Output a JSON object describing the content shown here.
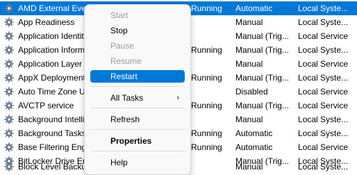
{
  "services": [
    {
      "name": "AMD External Events",
      "status": "Running",
      "startup": "Automatic",
      "logon": "Local Syste...",
      "selected": true
    },
    {
      "name": "App Readiness",
      "status": "",
      "startup": "Manual",
      "logon": "Local Syste..."
    },
    {
      "name": "Application Identity",
      "status": "",
      "startup": "Manual (Trig...",
      "logon": "Local Service"
    },
    {
      "name": "Application Information",
      "status": "Running",
      "startup": "Manual (Trig...",
      "logon": "Local Syste..."
    },
    {
      "name": "Application Layer Gateway",
      "status": "",
      "startup": "Manual",
      "logon": "Local Service"
    },
    {
      "name": "AppX Deployment Service",
      "status": "Running",
      "startup": "Manual (Trig...",
      "logon": "Local Syste..."
    },
    {
      "name": "Auto Time Zone Updater",
      "status": "",
      "startup": "Disabled",
      "logon": "Local Service"
    },
    {
      "name": "AVCTP service",
      "status": "Running",
      "startup": "Manual (Trig...",
      "logon": "Local Service"
    },
    {
      "name": "Background Intelligent",
      "status": "",
      "startup": "Manual",
      "logon": "Local Syste..."
    },
    {
      "name": "Background Tasks",
      "status": "Running",
      "startup": "Automatic",
      "logon": "Local Syste..."
    },
    {
      "name": "Base Filtering Engine",
      "status": "Running",
      "startup": "Automatic",
      "logon": "Local Service"
    },
    {
      "name": "BitLocker Drive Encryption",
      "status": "",
      "startup": "Manual (Trig...",
      "logon": "Local Syste..."
    },
    {
      "name": "Block Level Backup",
      "status": "",
      "startup": "Manual",
      "logon": "Local Syste..."
    }
  ],
  "context_menu": {
    "start": "Start",
    "stop": "Stop",
    "pause": "Pause",
    "resume": "Resume",
    "restart": "Restart",
    "all_tasks": "All Tasks",
    "all_tasks_arrow": "›",
    "refresh": "Refresh",
    "properties": "Properties",
    "help": "Help"
  },
  "colors": {
    "selection": "#0078d7",
    "disabled_text": "#9a9a9a",
    "gear_icon": "#6b7a8c"
  },
  "icons": {
    "service": "gear-icon"
  }
}
